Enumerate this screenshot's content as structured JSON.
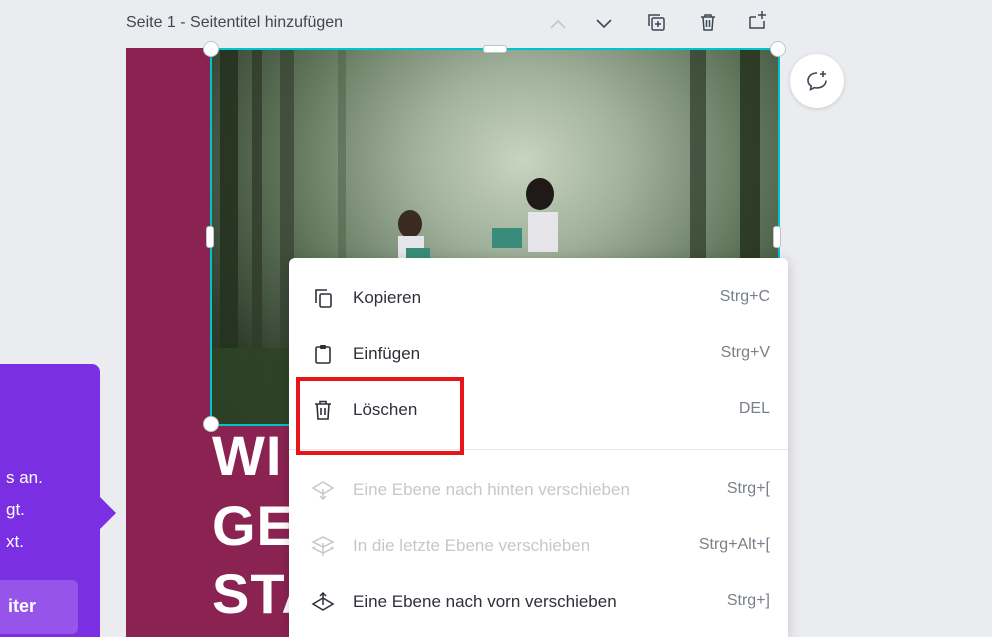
{
  "header": {
    "page_title": "Seite 1 - Seitentitel hinzufügen",
    "icons": [
      "chevron-up-icon",
      "chevron-down-icon",
      "duplicate-page-icon",
      "delete-page-icon",
      "add-page-icon"
    ]
  },
  "canvas": {
    "heading_lines": [
      "WI",
      "GE",
      "STA"
    ],
    "accent_color": "#8b2352",
    "selection_color": "#00c4cc"
  },
  "tooltip": {
    "lines": [
      "s an.",
      "gt.",
      "xt."
    ],
    "button_label": "iter",
    "color": "#7b2fe3"
  },
  "context_menu": {
    "items": [
      {
        "label": "Kopieren",
        "shortcut": "Strg+C",
        "icon": "copy-icon",
        "enabled": true
      },
      {
        "label": "Einfügen",
        "shortcut": "Strg+V",
        "icon": "paste-icon",
        "enabled": true
      },
      {
        "label": "Löschen",
        "shortcut": "DEL",
        "icon": "trash-icon",
        "enabled": true
      },
      {
        "label": "Eine Ebene nach hinten verschieben",
        "shortcut": "Strg+[",
        "icon": "send-backward-icon",
        "enabled": false
      },
      {
        "label": "In die letzte Ebene verschieben",
        "shortcut": "Strg+Alt+[",
        "icon": "send-to-back-icon",
        "enabled": false
      },
      {
        "label": "Eine Ebene nach vorn verschieben",
        "shortcut": "Strg+]",
        "icon": "bring-forward-icon",
        "enabled": true
      }
    ],
    "highlight_color": "#e8141a"
  }
}
